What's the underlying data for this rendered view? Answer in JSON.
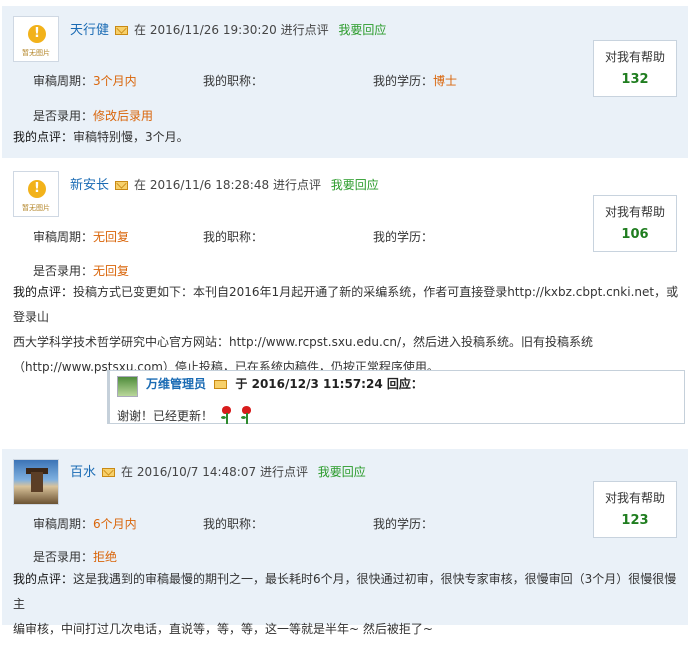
{
  "reviews": [
    {
      "username": "天行健",
      "avatar_caption": "暂无图片",
      "in_word": "在",
      "datetime": "2016/11/26 19:30:20",
      "action": "进行点评",
      "reply_link": "我要回应",
      "help_label": "对我有帮助",
      "help_count": "132",
      "period_label": "审稿周期：",
      "period_value": "3个月内",
      "title_label": "我的职称：",
      "title_value": "",
      "degree_label": "我的学历：",
      "degree_value": "博士",
      "accepted_label": "是否录用：",
      "accepted_value": "修改后录用",
      "comment_label": "我的点评：",
      "comment_text": "审稿特别慢，3个月。"
    },
    {
      "username": "新安长",
      "avatar_caption": "暂无图片",
      "in_word": "在",
      "datetime": "2016/11/6 18:28:48",
      "action": "进行点评",
      "reply_link": "我要回应",
      "help_label": "对我有帮助",
      "help_count": "106",
      "period_label": "审稿周期：",
      "period_value": "无回复",
      "title_label": "我的职称：",
      "title_value": "",
      "degree_label": "我的学历：",
      "degree_value": "",
      "accepted_label": "是否录用：",
      "accepted_value": "无回复",
      "comment_label": "我的点评：",
      "comment_line1": "投稿方式已变更如下：本刊自2016年1月起开通了新的采编系统，作者可直接登录http://kxbz.cbpt.cnki.net，或登录山",
      "comment_line2": "西大学科学技术哲学研究中心官方网站：http://www.rcpst.sxu.edu.cn/，然后进入投稿系统。旧有投稿系统",
      "comment_line3": "（http://www.pstsxu.com）停止投稿，已在系统内稿件，仍按正常程序使用。",
      "reply": {
        "name": "万维管理员",
        "at_word": "于",
        "datetime": "2016/12/3  11:57:24",
        "replied": "回应：",
        "text": "谢谢！已经更新！",
        "emoji": "rose-icon"
      }
    },
    {
      "username": "百水",
      "in_word": "在",
      "datetime": "2016/10/7 14:48:07",
      "action": "进行点评",
      "reply_link": "我要回应",
      "help_label": "对我有帮助",
      "help_count": "123",
      "period_label": "审稿周期：",
      "period_value": "6个月内",
      "title_label": "我的职称：",
      "title_value": "",
      "degree_label": "我的学历：",
      "degree_value": "",
      "accepted_label": "是否录用：",
      "accepted_value": "拒绝",
      "comment_label": "我的点评：",
      "comment_line1": "这是我遇到的审稿最慢的期刊之一，最长耗时6个月，很快通过初审，很快专家审核，很慢审回（3个月）很慢很慢主",
      "comment_line2": "编审核，中间打过几次电话，直说等，等，等，这一等就是半年~ 然后被拒了~"
    }
  ],
  "colors": {
    "panel_bg": "#eaf1f8",
    "username": "#1a6bb4",
    "reply_link": "#2a9b2a",
    "value_orange": "#d9650a",
    "help_count": "#1f7d1f"
  }
}
